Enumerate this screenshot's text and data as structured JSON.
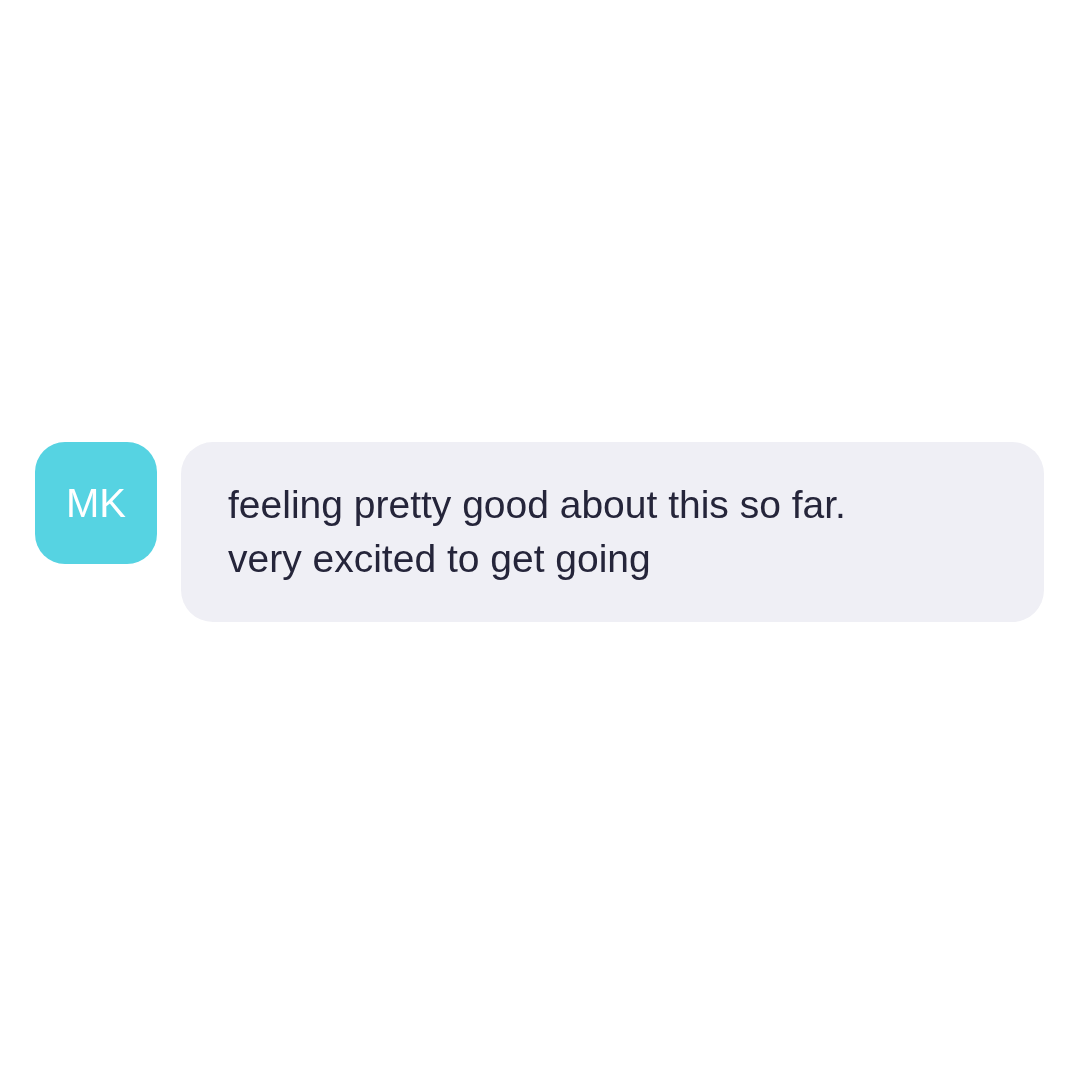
{
  "message": {
    "avatar": {
      "initials": "MK",
      "color": "#56d3e2"
    },
    "text": "feeling pretty good about this so far.\nvery excited to get going"
  }
}
